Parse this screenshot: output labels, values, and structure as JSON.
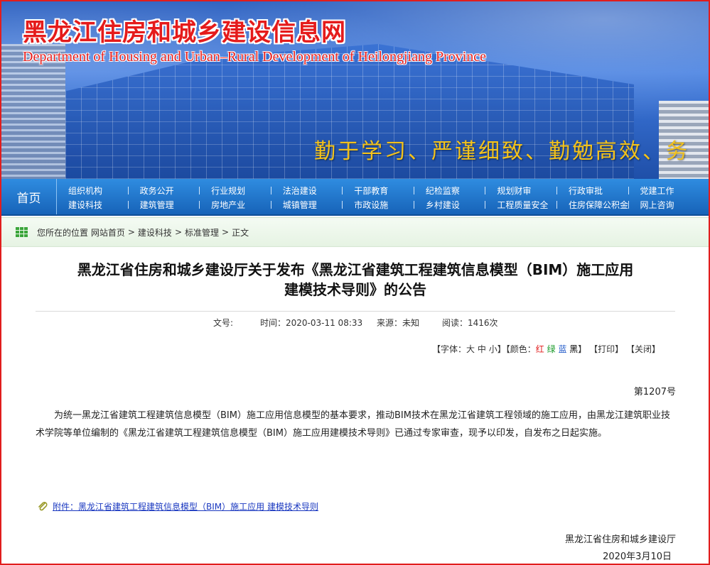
{
  "header": {
    "site_title": "黑龙江住房和城乡建设信息网",
    "site_subtitle": "Department of Housing and Urban–Rural Development of Heilongjiang Province",
    "slogan": "勤于学习、严谨细致、勤勉高效、务"
  },
  "nav": {
    "home": "首页",
    "row1": [
      "组织机构",
      "政务公开",
      "行业规划",
      "法治建设",
      "干部教育",
      "纪检监察",
      "规划财审",
      "行政审批",
      "党建工作"
    ],
    "row2": [
      "建设科技",
      "建筑管理",
      "房地产业",
      "城镇管理",
      "市政设施",
      "乡村建设",
      "工程质量安全",
      "住房保障公积金",
      "网上咨询"
    ]
  },
  "breadcrumb": {
    "prefix": "您所在的位置",
    "items": [
      "网站首页",
      "建设科技",
      "标准管理",
      "正文"
    ],
    "separator": ">"
  },
  "article": {
    "title_line1": "黑龙江省住房和城乡建设厅关于发布《黑龙江省建筑工程建筑信息模型（BIM）施工应用",
    "title_line2": "建模技术导则》的公告",
    "meta": {
      "doc_label": "文号:",
      "time": "时间：2020-03-11 08:33",
      "source": "来源：未知",
      "reads": "阅读：1416次"
    },
    "tools": {
      "font_open": "【字体：",
      "font_big": "大",
      "font_mid": "中",
      "font_small": "小",
      "font_close": "】",
      "color_open": "【颜色：",
      "color_red": "红",
      "color_green": "绿",
      "color_blue": "蓝",
      "color_black": "黑",
      "color_close": "】",
      "print": "【打印】",
      "close": "【关闭】"
    },
    "doc_number": "第1207号",
    "paragraph": "为统一黑龙江省建筑工程建筑信息模型（BIM）施工应用信息模型的基本要求，推动BIM技术在黑龙江省建筑工程领域的施工应用，由黑龙江建筑职业技术学院等单位编制的《黑龙江省建筑工程建筑信息模型（BIM）施工应用建模技术导则》已通过专家审查，现予以印发，自发布之日起实施。",
    "attachment": "附件：黑龙江省建筑工程建筑信息模型（BIM）施工应用 建模技术导则",
    "sign_org": "黑龙江省住房和城乡建设厅",
    "sign_date": "2020年3月10日"
  },
  "colors": {
    "frame": "#e11d1d",
    "nav_bg": "#1f75cc",
    "title_red": "#e51b1b",
    "slogan_gold": "#f3c21b",
    "link_blue": "#1a38c0"
  },
  "icons": [
    "breadcrumb-grid-icon",
    "paperclip-icon"
  ]
}
